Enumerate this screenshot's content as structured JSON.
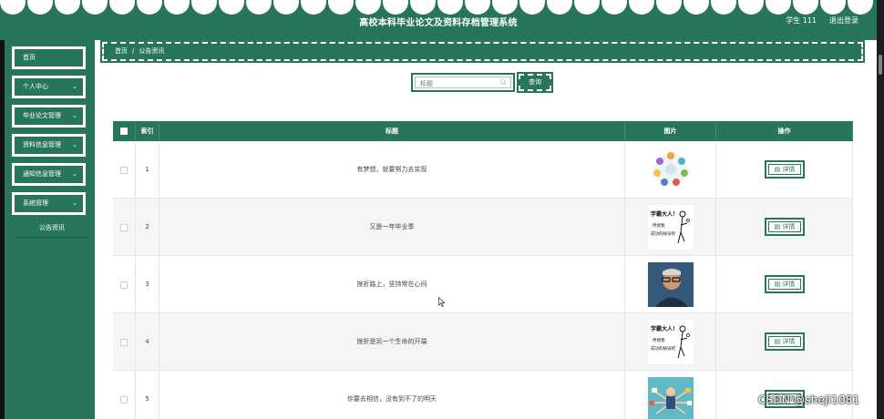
{
  "header": {
    "title": "高校本科毕业论文及资料存档管理系统",
    "user": "学生 111",
    "logout": "退出登录"
  },
  "sidebar": {
    "items": [
      {
        "label": "首页",
        "has_chevron": false
      },
      {
        "label": "个人中心",
        "has_chevron": true
      },
      {
        "label": "毕业论文管理",
        "has_chevron": true
      },
      {
        "label": "资料信息管理",
        "has_chevron": true
      },
      {
        "label": "通知信息管理",
        "has_chevron": true
      },
      {
        "label": "系统管理",
        "has_chevron": true
      }
    ],
    "sub_item": "公告资讯"
  },
  "breadcrumb": {
    "home": "首页",
    "separator": "/",
    "current": "公告资讯"
  },
  "search": {
    "placeholder": "标题",
    "value": "",
    "button_label": "查询"
  },
  "table": {
    "columns": [
      "索引",
      "标题",
      "图片",
      "操作"
    ],
    "rows": [
      {
        "index": "1",
        "title": "有梦想，就要努力去实现",
        "image": "infographic-circle",
        "action": "详情"
      },
      {
        "index": "2",
        "title": "又是一年毕业季",
        "image": "stick-figure-poster",
        "action": "详情"
      },
      {
        "index": "3",
        "title": "挫折路上，坚持常在心间",
        "image": "man-with-glasses-photo",
        "action": "详情"
      },
      {
        "index": "4",
        "title": "挫折是另一个生命的开端",
        "image": "stick-figure-poster",
        "action": "详情"
      },
      {
        "index": "5",
        "title": "你要去相信，没有到不了的明天",
        "image": "multi-arm-illustration",
        "action": "详情"
      }
    ],
    "poster_text": [
      "学霸大人！",
      "传授我",
      "成功的秘诀吧"
    ]
  },
  "watermark": "CSDN @sheji1081",
  "colors": {
    "primary": "#27765a",
    "white": "#ffffff",
    "row_alt": "#f5f5f5"
  }
}
